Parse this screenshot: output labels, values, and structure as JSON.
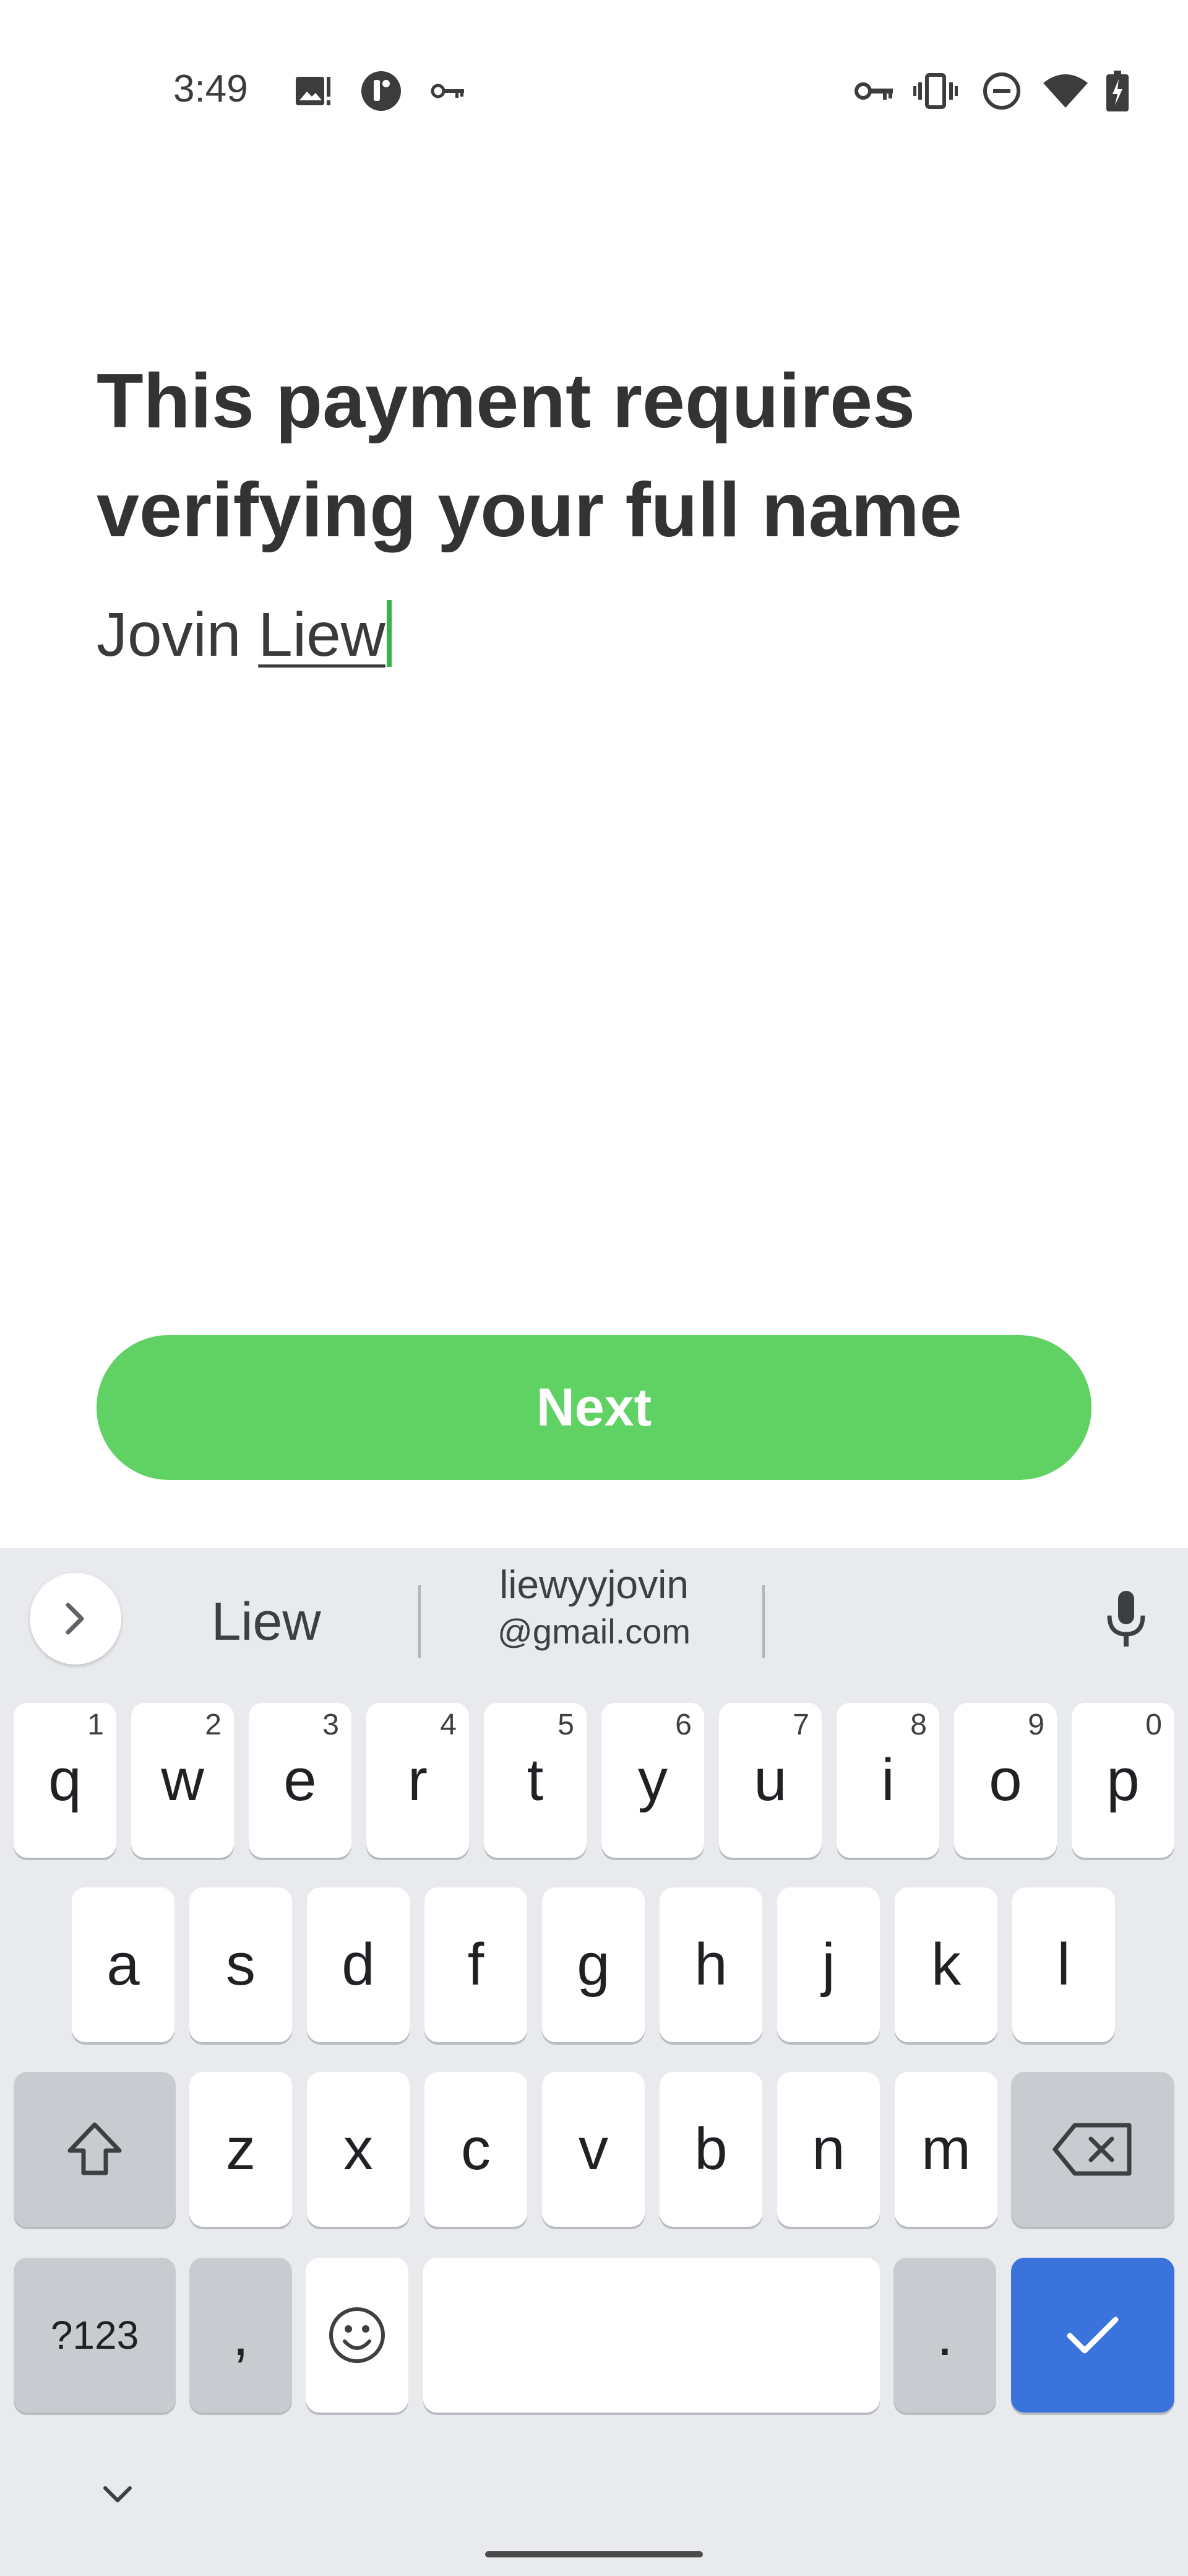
{
  "status_bar": {
    "time": "3:49",
    "left_icons": [
      "image-alert-icon",
      "app-notification-icon",
      "vpn-key-icon"
    ],
    "right_icons": [
      "vpn-key-icon",
      "vibrate-icon",
      "do-not-disturb-icon",
      "wifi-icon",
      "battery-charging-icon"
    ]
  },
  "screen": {
    "title": "This payment requires verifying your full name",
    "name_value_plain": "Jovin ",
    "name_value_composing": "Liew",
    "next_label": "Next",
    "accent_color": "#60d263"
  },
  "keyboard": {
    "suggestions": [
      "Liew"
    ],
    "email_suggestion_line1": "liewyyjovin",
    "email_suggestion_line2": "@gmail.com",
    "row1": [
      {
        "k": "q",
        "h": "1"
      },
      {
        "k": "w",
        "h": "2"
      },
      {
        "k": "e",
        "h": "3"
      },
      {
        "k": "r",
        "h": "4"
      },
      {
        "k": "t",
        "h": "5"
      },
      {
        "k": "y",
        "h": "6"
      },
      {
        "k": "u",
        "h": "7"
      },
      {
        "k": "i",
        "h": "8"
      },
      {
        "k": "o",
        "h": "9"
      },
      {
        "k": "p",
        "h": "0"
      }
    ],
    "row2": [
      "a",
      "s",
      "d",
      "f",
      "g",
      "h",
      "j",
      "k",
      "l"
    ],
    "row3": [
      "z",
      "x",
      "c",
      "v",
      "b",
      "n",
      "m"
    ],
    "symbols_label": "?123",
    "comma_label": ",",
    "period_label": ".",
    "enter_color": "#3a73db"
  }
}
